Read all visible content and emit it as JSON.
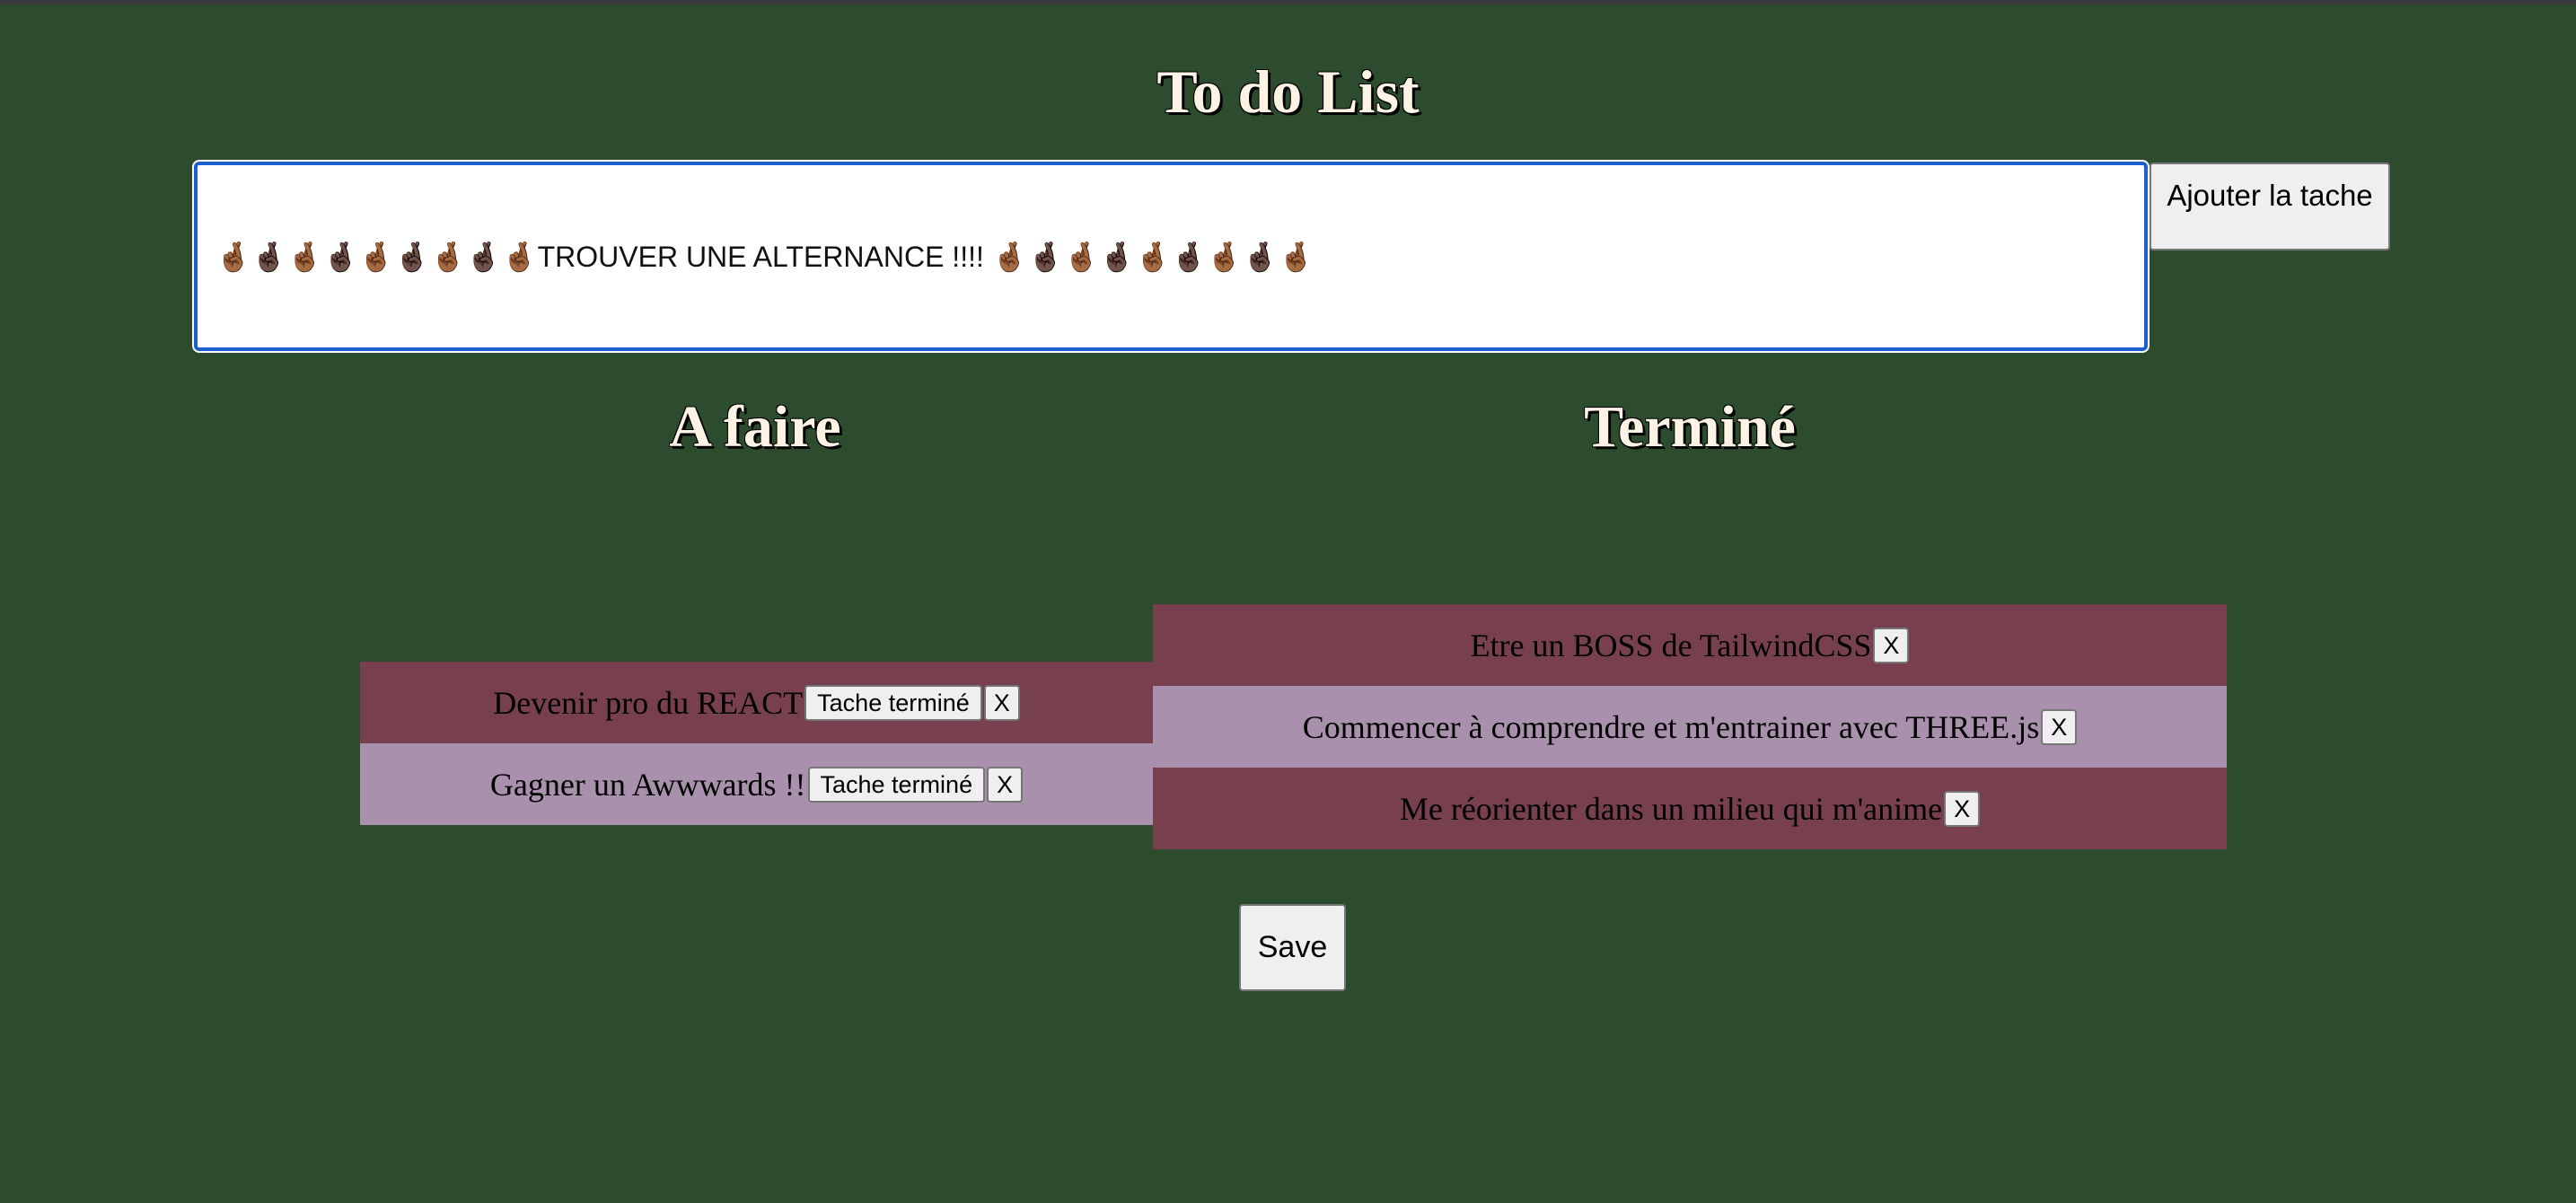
{
  "app": {
    "title": "To do List"
  },
  "input": {
    "value": "🤞🏾🤞🏿🤞🏾🤞🏿🤞🏾🤞🏿🤞🏾🤞🏿🤞🏾TROUVER UNE ALTERNANCE !!!! 🤞🏾🤞🏿🤞🏾🤞🏿🤞🏾🤞🏿🤞🏾🤞🏿🤞🏾",
    "add_label": "Ajouter la tache"
  },
  "columns": {
    "todo_title": "A faire",
    "done_title": "Terminé"
  },
  "todo": {
    "items": [
      {
        "text": "Devenir pro du REACT",
        "done_label": "Tache terminé",
        "delete_label": "X"
      },
      {
        "text": "Gagner un Awwwards !!",
        "done_label": "Tache terminé",
        "delete_label": "X"
      }
    ]
  },
  "done": {
    "items": [
      {
        "text": "Etre un BOSS de TailwindCSS",
        "delete_label": "X"
      },
      {
        "text": "Commencer à comprendre et m'entrainer avec THREE.js",
        "delete_label": "X"
      },
      {
        "text": "Me réorienter dans un milieu qui m'anime",
        "delete_label": "X"
      }
    ]
  },
  "save_label": "Save",
  "colors": {
    "background": "#2d4c2e",
    "row_dark": "#78404e",
    "row_light": "#a990ad",
    "heading": "#fdf3e4",
    "input_focus": "#1c5fd1"
  }
}
